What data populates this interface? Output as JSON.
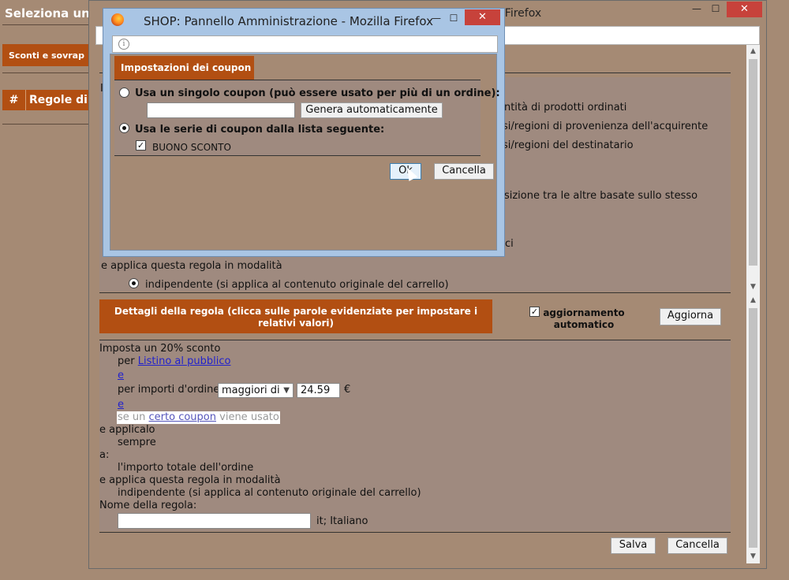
{
  "background": {
    "title": "Seleziona una",
    "tab": "Sconti e sovrap",
    "table_hash": "#",
    "table_label": "Regole di"
  },
  "window": {
    "title": "lla Firefox",
    "min": "—",
    "max": "☐",
    "close": "✕"
  },
  "rule_options": {
    "top_letter": "I",
    "line1": "antità di prodotti ordinati",
    "line2": "si/regioni di provenienza dell'acquirente",
    "line3": "si/regioni del destinatario",
    "line4": "osizione tra le altre basate sullo stesso",
    "line5": "ci",
    "mode_label": "e applica questa regola in modalità",
    "mode_option": "indipendente (si applica al contenuto originale del carrello)"
  },
  "details": {
    "header": "Dettagli della regola (clicca sulle parole evidenziate per impostare i relativi valori)",
    "auto_update_label": "aggiornamento automatico",
    "update_button": "Aggiorna"
  },
  "rule_body": {
    "discount": "Imposta un 20% sconto",
    "per_label": "per",
    "price_list_link": "Listino al pubblico",
    "and1": "e",
    "amount_label": "per importi d'ordine",
    "amount_operator": "maggiori di",
    "amount_value": "24.59",
    "currency": "€",
    "and2": "e",
    "coupon_prefix": "se un",
    "coupon_link": "certo coupon",
    "coupon_suffix": "viene usato",
    "apply_label": "e applicalo",
    "apply_value": "sempre",
    "to_label": "a:",
    "to_value": "l'importo totale dell'ordine",
    "mode_label": "e applica questa regola in modalità",
    "mode_value": "indipendente (si applica al contenuto originale del carrello)",
    "name_label": "Nome della regola:",
    "name_value": "",
    "name_lang": "it; Italiano"
  },
  "footer": {
    "save": "Salva",
    "cancel": "Cancella"
  },
  "dialog": {
    "title": "SHOP: Pannello Amministrazione - Mozilla Firefox",
    "info": "i",
    "tab": "Impostazioni dei coupon",
    "single_label": "Usa un singolo coupon (può essere usato per più di un ordine):",
    "single_value": "",
    "generate": "Genera automaticamente",
    "series_label": "Usa le serie di coupon dalla lista seguente:",
    "series_item": "BUONO SCONTO",
    "ok": "Ok",
    "cancel": "Cancella",
    "min": "—",
    "max": "☐",
    "close": "✕"
  }
}
